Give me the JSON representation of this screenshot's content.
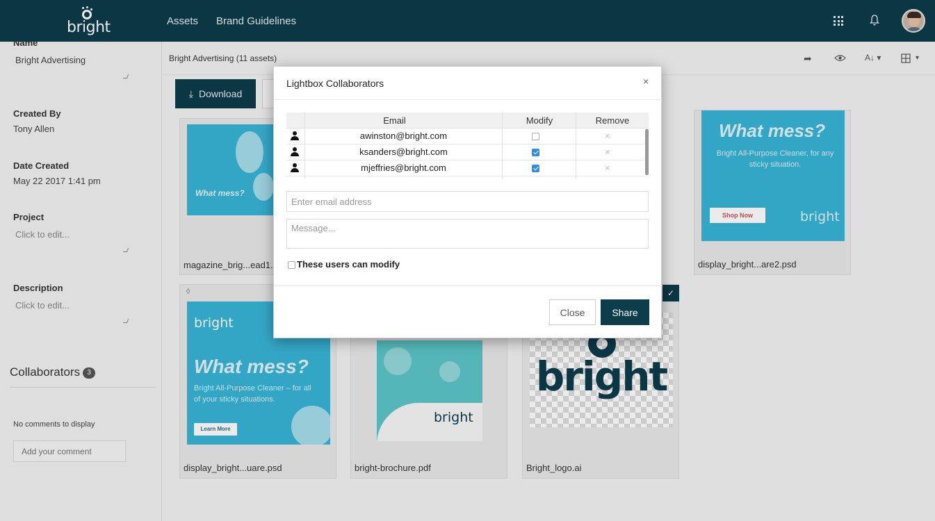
{
  "brand": {
    "logo_text": "bright"
  },
  "nav": {
    "assets": "Assets",
    "brand_guidelines": "Brand Guidelines"
  },
  "sidebar": {
    "name_label": "Name",
    "name_value": "Bright Advertising",
    "created_by_label": "Created By",
    "created_by_value": "Tony Allen",
    "date_created_label": "Date Created",
    "date_created_value": "May 22 2017 1:41 pm",
    "project_label": "Project",
    "project_value": "Click to edit...",
    "description_label": "Description",
    "description_value": "Click to edit...",
    "collaborators_title": "Collaborators",
    "collaborators_count": "3",
    "no_comments": "No comments to display",
    "comment_placeholder": "Add your comment"
  },
  "main": {
    "breadcrumb": "Bright Advertising (11 assets)",
    "download_label": "Download",
    "assets": [
      {
        "filename": "magazine_brig...ead1.",
        "headline": "What mess?"
      },
      {
        "filename": "display_bright...are2.psd",
        "headline": "What mess?",
        "sub": "Bright All-Purpose Cleaner, for any sticky situation.",
        "cta": "Shop Now",
        "logo": "bright"
      },
      {
        "filename": "display_bright...uare.psd",
        "headline": "What mess?",
        "sub": "Bright All-Purpose Cleaner – for all of your sticky situations.",
        "cta": "Learn More",
        "logo": "bright"
      },
      {
        "filename": "bright-brochure.pdf",
        "logo": "bright"
      },
      {
        "filename": "Bright_logo.ai",
        "logo": "bright"
      }
    ]
  },
  "modal": {
    "title": "Lightbox Collaborators",
    "close_symbol": "×",
    "columns": {
      "email": "Email",
      "modify": "Modify",
      "remove": "Remove"
    },
    "rows": [
      {
        "email": "awinston@bright.com",
        "modify": false
      },
      {
        "email": "ksanders@bright.com",
        "modify": true
      },
      {
        "email": "mjeffries@bright.com",
        "modify": true
      }
    ],
    "remove_symbol": "×",
    "email_placeholder": "Enter email address",
    "message_placeholder": "Message...",
    "modify_label": "These users can modify",
    "modify_checked": false,
    "close_label": "Close",
    "share_label": "Share"
  },
  "colors": {
    "nav_bg": "#0d3c4b",
    "primary_button": "#0d3c4b",
    "ad_teal": "#39b5d6",
    "checkbox_blue": "#2f8ee8"
  }
}
